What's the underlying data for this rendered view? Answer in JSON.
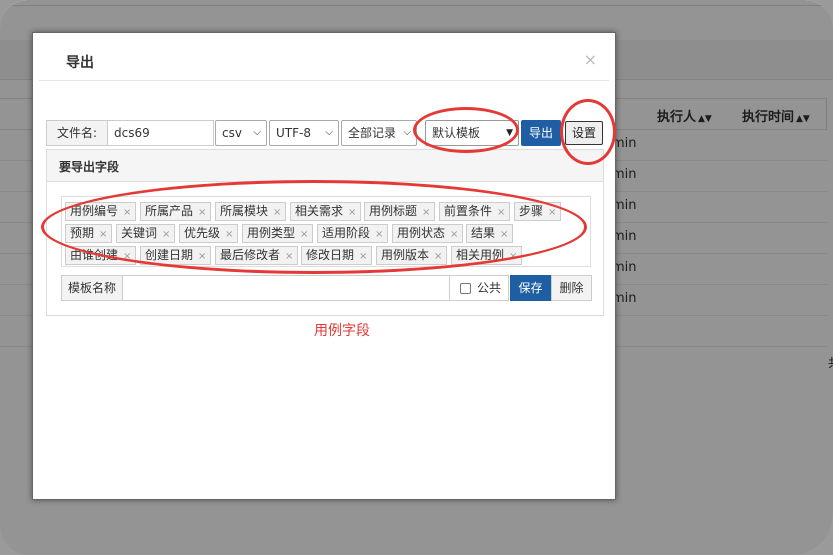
{
  "background": {
    "columns": [
      {
        "label": "执行人",
        "sort_icon": "sort-icon"
      },
      {
        "label": "执行时间",
        "sort_icon": "sort-icon"
      }
    ],
    "cell_values": [
      "min",
      "min",
      "min",
      "min",
      "min",
      "min"
    ],
    "tail_text": "共"
  },
  "modal": {
    "title": "导出",
    "close": "×",
    "toolbar": {
      "filename_label": "文件名:",
      "filename_value": "dcs69",
      "format_value": "csv",
      "encoding_value": "UTF-8",
      "range_value": "全部记录",
      "template_value": "默认模板",
      "export_button": "导出",
      "setting_button": "设置"
    },
    "fields_panel": {
      "title": "要导出字段",
      "tags": [
        "用例编号",
        "所属产品",
        "所属模块",
        "相关需求",
        "用例标题",
        "前置条件",
        "步骤",
        "预期",
        "关键词",
        "优先级",
        "用例类型",
        "适用阶段",
        "用例状态",
        "结果",
        "由谁创建",
        "创建日期",
        "最后修改者",
        "修改日期",
        "用例版本",
        "相关用例"
      ],
      "tag_remove_glyph": "×"
    },
    "template_row": {
      "label": "模板名称",
      "name_value": "",
      "public_label": "公共",
      "public_checked": false,
      "save_button": "保存",
      "delete_button": "删除"
    },
    "annotation_text": "用例字段"
  },
  "colors": {
    "primary_button": "#1e5ea3",
    "annotation_red": "#e53935"
  }
}
